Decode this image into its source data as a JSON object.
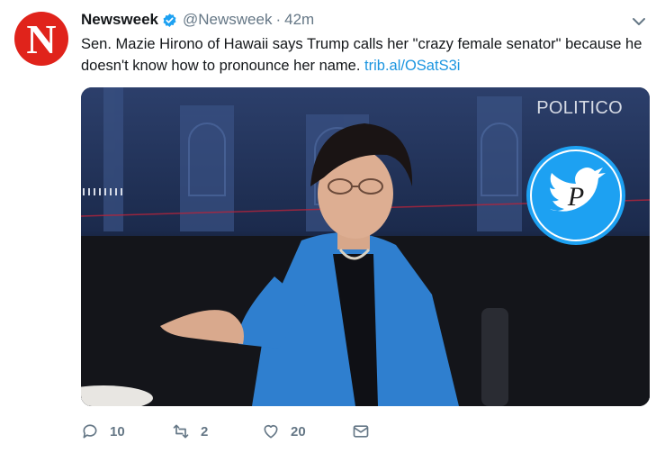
{
  "tweet": {
    "avatar_letter": "N",
    "author_name": "Newsweek",
    "handle": "@Newsweek",
    "separator": "·",
    "timestamp": "42m",
    "text": "Sen. Mazie Hirono of Hawaii says Trump calls her \"crazy female senator\" because he doesn't know how to pronounce her name.",
    "link_text": "trib.al/OSatS3i",
    "media": {
      "watermark": "POLITICO",
      "overlay_icon": "twitter-bird-icon"
    },
    "actions": {
      "reply_count": "10",
      "retweet_count": "2",
      "like_count": "20"
    }
  },
  "colors": {
    "brand_red": "#e0231b",
    "link_blue": "#1b95e0",
    "verified_blue": "#1da1f2",
    "muted_gray": "#657786"
  }
}
